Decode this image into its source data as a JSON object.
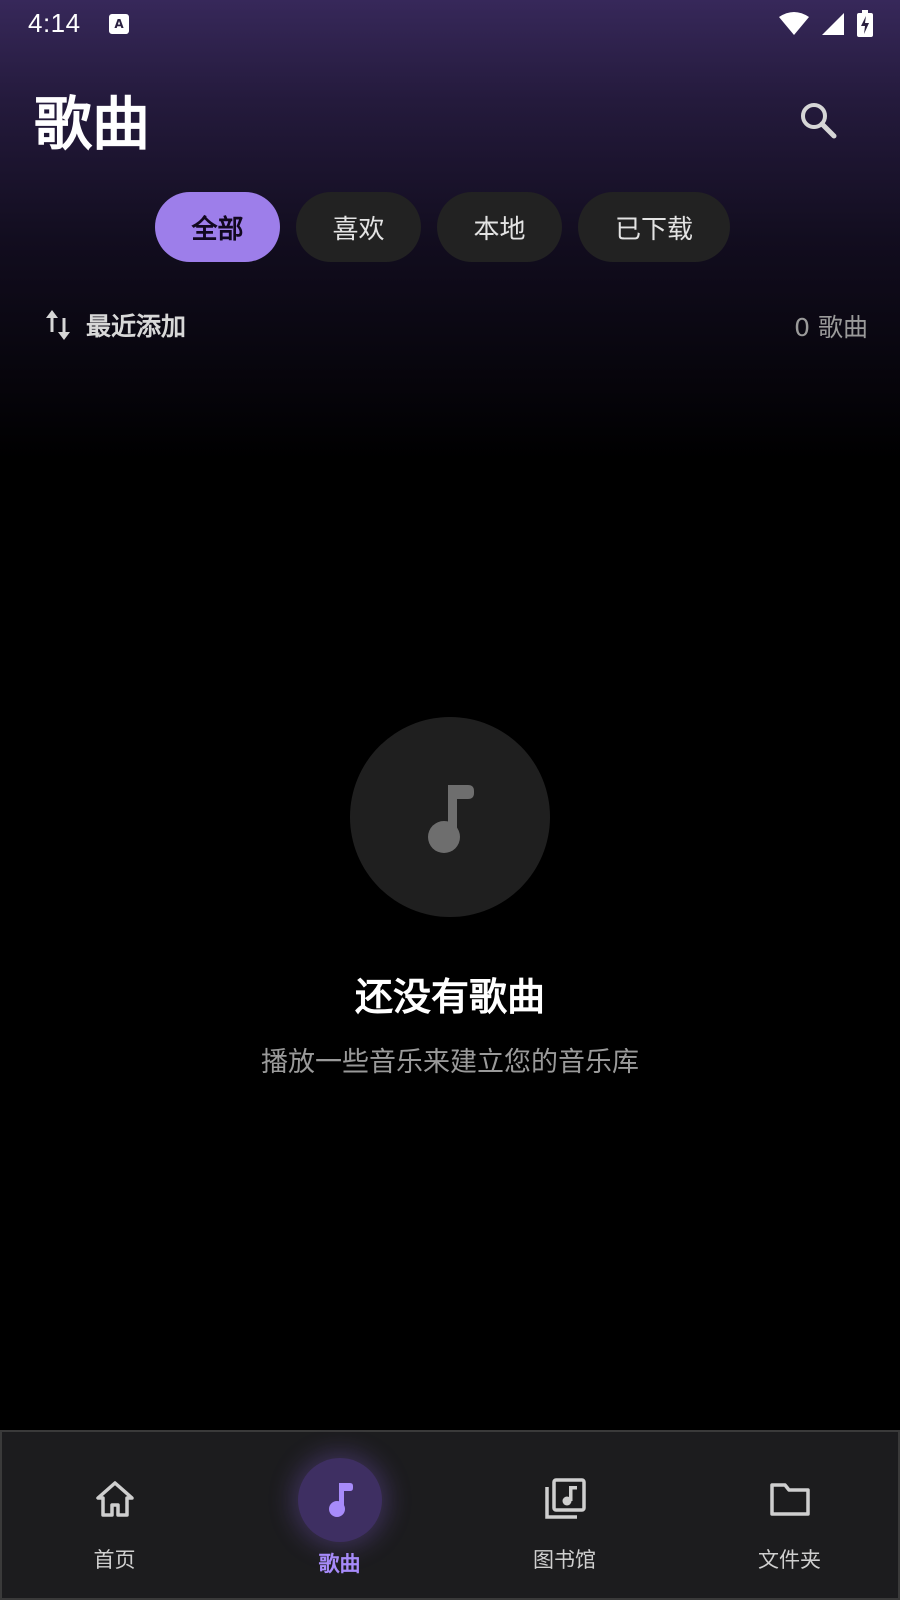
{
  "status_bar": {
    "time": "4:14"
  },
  "header": {
    "title": "歌曲"
  },
  "filters": [
    {
      "label": "全部",
      "selected": true
    },
    {
      "label": "喜欢",
      "selected": false
    },
    {
      "label": "本地",
      "selected": false
    },
    {
      "label": "已下载",
      "selected": false
    }
  ],
  "sort": {
    "label": "最近添加",
    "count_text": "0 歌曲"
  },
  "empty_state": {
    "title": "还没有歌曲",
    "subtitle": "播放一些音乐来建立您的音乐库"
  },
  "bottom_nav": {
    "items": [
      {
        "label": "首页",
        "icon": "home-icon",
        "active": false
      },
      {
        "label": "歌曲",
        "icon": "music-note-icon",
        "active": true
      },
      {
        "label": "图书馆",
        "icon": "library-music-icon",
        "active": false
      },
      {
        "label": "文件夹",
        "icon": "folder-icon",
        "active": false
      }
    ]
  },
  "colors": {
    "accent": "#9d7eea",
    "accent_text": "#a78bfa",
    "chip_bg": "#222222",
    "nav_bg": "#1c1c1e"
  }
}
